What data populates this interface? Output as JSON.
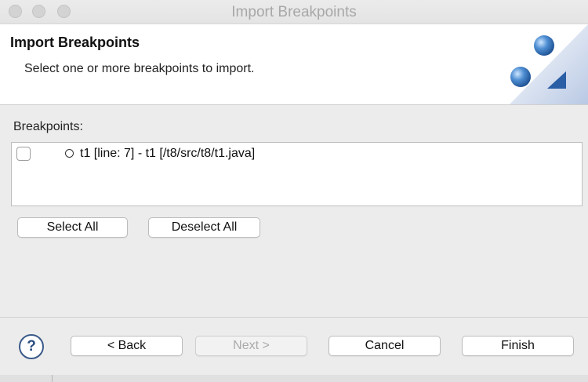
{
  "window": {
    "title": "Import Breakpoints"
  },
  "header": {
    "title": "Import Breakpoints",
    "description": "Select one or more breakpoints to import."
  },
  "breakpoints": {
    "label": "Breakpoints:",
    "items": [
      {
        "text": "t1 [line: 7] - t1 [/t8/src/t8/t1.java]",
        "checked": false
      }
    ]
  },
  "selection_buttons": {
    "select_all": "Select All",
    "deselect_all": "Deselect All"
  },
  "footer": {
    "help": "?",
    "back": "< Back",
    "next": "Next >",
    "cancel": "Cancel",
    "finish": "Finish",
    "next_enabled": false
  },
  "colors": {
    "help_icon": "#2a4d80",
    "banner_blue": "#3a78c0"
  }
}
